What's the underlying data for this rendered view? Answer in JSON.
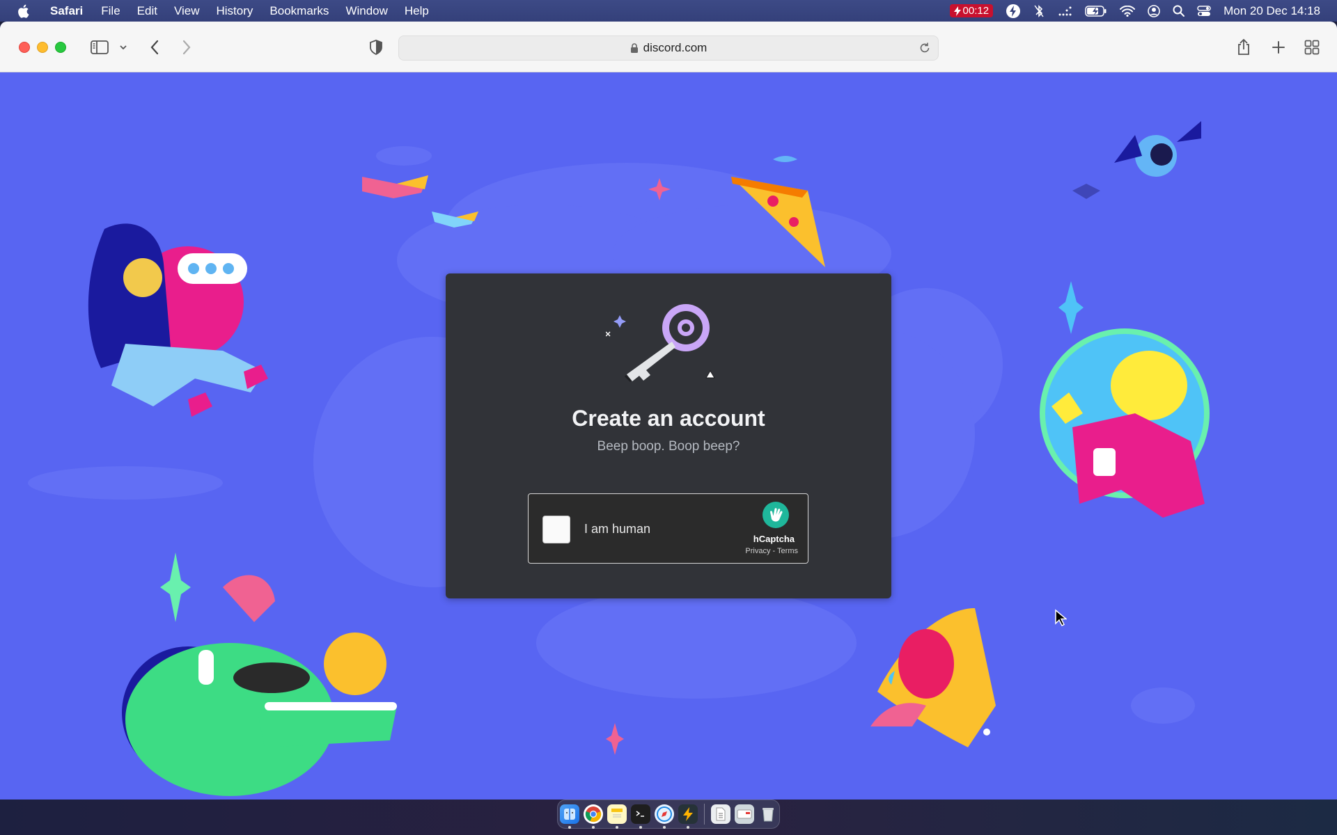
{
  "menubar": {
    "app_name": "Safari",
    "items": [
      "File",
      "Edit",
      "View",
      "History",
      "Bookmarks",
      "Window",
      "Help"
    ],
    "timer": "00:12",
    "clock": "Mon 20 Dec  14:18"
  },
  "browser": {
    "url": "discord.com"
  },
  "modal": {
    "title": "Create an account",
    "subtitle": "Beep boop. Boop beep?"
  },
  "captcha": {
    "label": "I am human",
    "brand": "hCaptcha",
    "links": "Privacy - Terms",
    "checked": false
  },
  "colors": {
    "background": "#5865f2",
    "modal": "#313338",
    "accent": "#5865f2"
  }
}
